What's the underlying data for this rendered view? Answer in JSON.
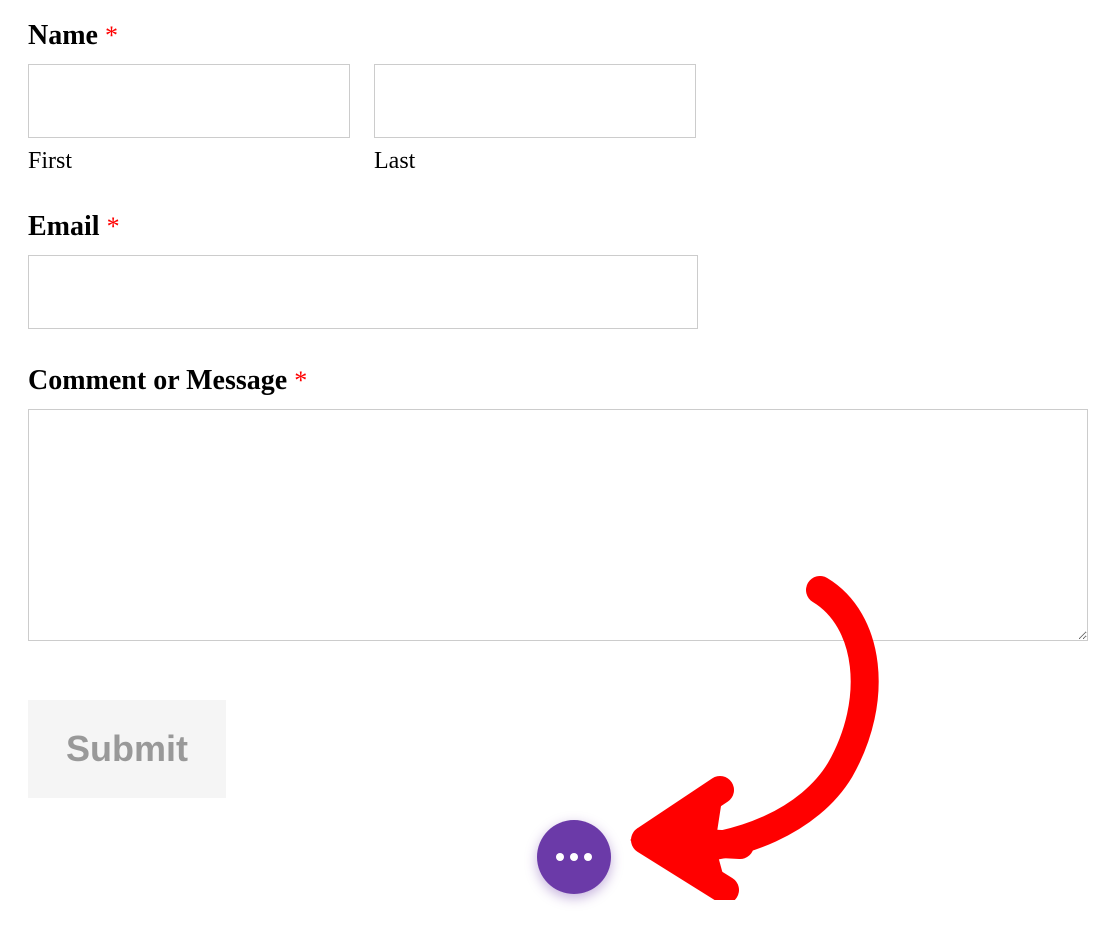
{
  "form": {
    "name": {
      "label": "Name",
      "required_marker": "*",
      "first_sublabel": "First",
      "last_sublabel": "Last",
      "first_value": "",
      "last_value": ""
    },
    "email": {
      "label": "Email",
      "required_marker": "*",
      "value": ""
    },
    "comment": {
      "label": "Comment or Message",
      "required_marker": "*",
      "value": ""
    },
    "submit": {
      "label": "Submit"
    }
  },
  "fab": {
    "icon_name": "more-horizontal-icon"
  },
  "colors": {
    "required": "#ff0000",
    "fab_bg": "#6b3aa8",
    "submit_bg": "#f5f5f5",
    "submit_text": "#999999",
    "arrow": "#ff0000"
  }
}
